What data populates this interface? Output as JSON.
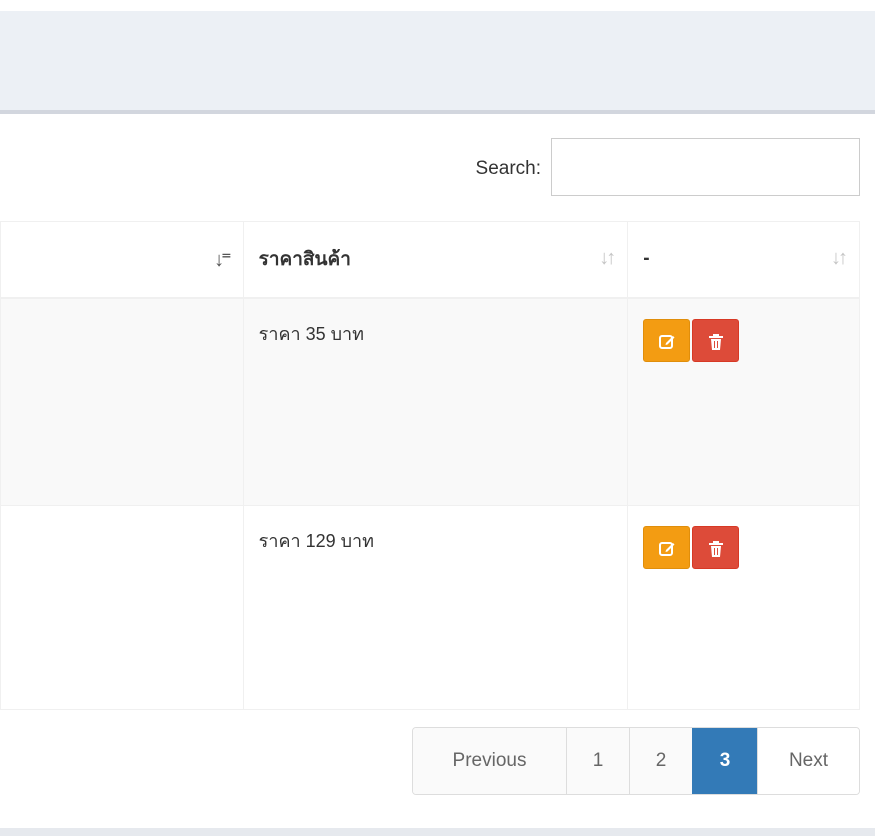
{
  "search": {
    "label": "Search:",
    "value": "",
    "placeholder": ""
  },
  "table": {
    "columns": [
      {
        "label": ""
      },
      {
        "label": "ราคาสินค้า"
      },
      {
        "label": "-"
      }
    ],
    "rows": [
      {
        "name": "",
        "price": "ราคา 35 บาท"
      },
      {
        "name": "",
        "price": "ราคา 129 บาท"
      }
    ]
  },
  "pagination": {
    "previous": "Previous",
    "pages": [
      "1",
      "2",
      "3"
    ],
    "current": "3",
    "next": "Next"
  },
  "icons": {
    "sort_active": "sort-amount-desc-icon",
    "sort_inactive": "sort-icon",
    "edit": "edit-icon",
    "delete": "trash-icon"
  },
  "colors": {
    "edit_button": "#f39c12",
    "delete_button": "#dd4b39",
    "active_page": "#337ab7",
    "header_band": "#ecf0f5"
  }
}
